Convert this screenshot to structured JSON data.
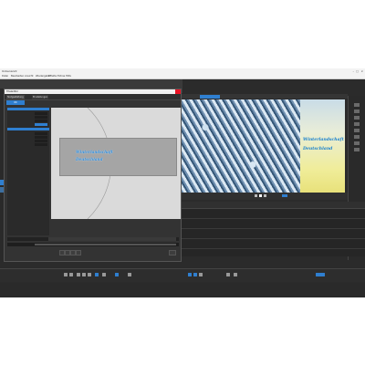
{
  "app": {
    "title": "Unbenannt",
    "menu": [
      "Datei",
      "Bearbeiten",
      "Ansicht",
      "Wiedergabe",
      "Effekte",
      "Extras",
      "Hilfe"
    ]
  },
  "dialog": {
    "title": "Titeleditor",
    "tabs": [
      "Textgestaltung",
      "Einstellungen"
    ],
    "action_button": "OK"
  },
  "overlay_text": {
    "line1": "Winterlandschaft",
    "line2": "Deutschland"
  },
  "colors": {
    "accent": "#2f7fd0",
    "text_blue": "#2a88d8",
    "close": "#e81123"
  },
  "icons": [
    "play-icon",
    "pause-icon",
    "stop-icon",
    "cut-icon",
    "undo-icon",
    "redo-icon",
    "zoom-icon",
    "gear-icon"
  ]
}
